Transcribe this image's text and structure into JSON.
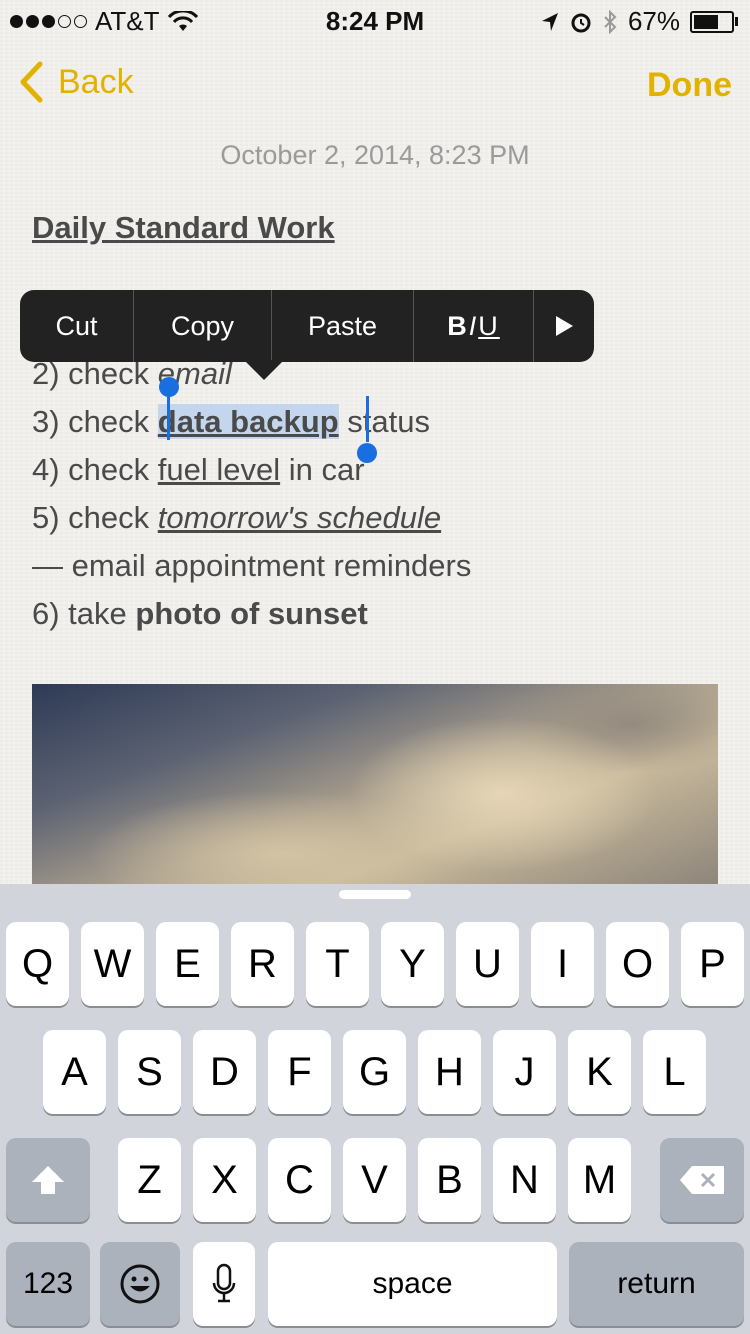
{
  "status_bar": {
    "carrier": "AT&T",
    "time": "8:24 PM",
    "battery_percent": "67%",
    "battery_level": 0.67,
    "signal_bars_filled": 3,
    "signal_bars_total": 5
  },
  "nav": {
    "back_label": "Back",
    "done_label": "Done",
    "accent_color": "#e3b200"
  },
  "note": {
    "date": "October 2, 2014, 8:23 PM",
    "title": "Daily Standard Work",
    "lines": {
      "l2_prefix": "2) check ",
      "l2_item": "email",
      "l3_prefix": "3) check ",
      "l3_item": "data backup",
      "l3_suffix": " status",
      "l4_prefix": "4) check ",
      "l4_item": "fuel level",
      "l4_suffix": " in car",
      "l5_prefix": "5) check ",
      "l5_item": "tomorrow's schedule",
      "l5b": "— email appointment reminders",
      "l6_prefix": "6) take ",
      "l6_item": "photo of sunset"
    },
    "selected_text": "data backup"
  },
  "edit_menu": {
    "cut": "Cut",
    "copy": "Copy",
    "paste": "Paste",
    "bold": "B",
    "italic": "I",
    "underline": "U"
  },
  "keyboard": {
    "row1": [
      "Q",
      "W",
      "E",
      "R",
      "T",
      "Y",
      "U",
      "I",
      "O",
      "P"
    ],
    "row2": [
      "A",
      "S",
      "D",
      "F",
      "G",
      "H",
      "J",
      "K",
      "L"
    ],
    "row3": [
      "Z",
      "X",
      "C",
      "V",
      "B",
      "N",
      "M"
    ],
    "numbers_label": "123",
    "space_label": "space",
    "return_label": "return"
  },
  "icons": {
    "back": "chevron-left-icon",
    "more": "triangle-right-icon",
    "shift": "shift-arrow-icon",
    "delete": "backspace-icon",
    "emoji": "smiley-icon",
    "mic": "microphone-icon"
  }
}
